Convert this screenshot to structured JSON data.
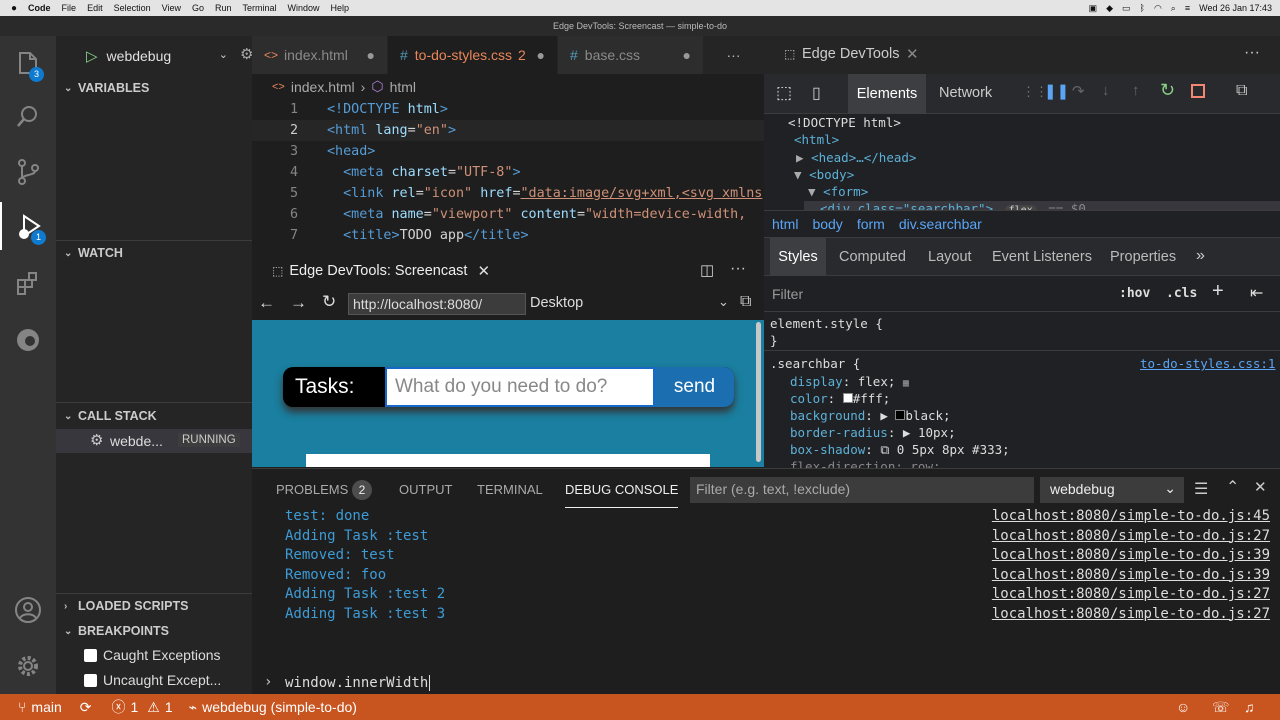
{
  "macbar": {
    "app": "Code",
    "menus": [
      "File",
      "Edit",
      "Selection",
      "View",
      "Go",
      "Run",
      "Terminal",
      "Window",
      "Help"
    ],
    "clock": "Wed 26 Jan  17:43"
  },
  "window_title": "Edge DevTools: Screencast — simple-to-do",
  "activity": {
    "explorer_badge": "3",
    "debug_badge": "1"
  },
  "sidebar": {
    "config": "webdebug",
    "variables": "VARIABLES",
    "watch": "WATCH",
    "call_stack": "CALL STACK",
    "call_stack_item": "webde...",
    "call_stack_status": "RUNNING",
    "loaded_scripts": "LOADED SCRIPTS",
    "breakpoints": "BREAKPOINTS",
    "bp1": "Caught Exceptions",
    "bp2": "Uncaught Except..."
  },
  "editor": {
    "tabs": [
      {
        "label": "index.html",
        "icon": "<>"
      },
      {
        "label": "to-do-styles.css",
        "count": "2",
        "icon": "#"
      },
      {
        "label": "base.css",
        "icon": "#"
      }
    ],
    "breadcrumb": {
      "file": "index.html",
      "node": "html"
    },
    "lines": [
      "1",
      "2",
      "3",
      "4",
      "5",
      "6",
      "7"
    ]
  },
  "screencast": {
    "tab": "Edge DevTools: Screencast",
    "url": "http://localhost:8080/",
    "device": "Desktop",
    "label": "Tasks:",
    "placeholder": "What do you need to do?",
    "send": "send"
  },
  "devtools": {
    "tab": "Edge DevTools",
    "tools": [
      "Elements",
      "Network"
    ],
    "dom": [
      "<!DOCTYPE html>",
      "<html>",
      "<head>…</head>",
      "<body>",
      "<form>"
    ],
    "dom_last": "<div class=\"searchbar\">",
    "dom_pill": "flex",
    "dom_eq": "== $0",
    "crumbs": [
      "html",
      "body",
      "form",
      "div.searchbar"
    ],
    "style_tabs": [
      "Styles",
      "Computed",
      "Layout",
      "Event Listeners",
      "Properties"
    ],
    "filter": "Filter",
    "hov": ":hov",
    "cls": ".cls",
    "element_style": "element.style {",
    "brace": "}",
    "selector": ".searchbar {",
    "source": "to-do-styles.css:1",
    "props": [
      {
        "name": "display",
        "value": "flex;"
      },
      {
        "name": "color",
        "value": "#fff;"
      },
      {
        "name": "background",
        "value": "black;"
      },
      {
        "name": "border-radius",
        "value": "10px;"
      },
      {
        "name": "box-shadow",
        "value": "0 5px 8px  #333;"
      }
    ],
    "cut_prop": "flex-direction: row;"
  },
  "panel": {
    "tabs": [
      "PROBLEMS",
      "OUTPUT",
      "TERMINAL",
      "DEBUG CONSOLE"
    ],
    "problems_count": "2",
    "filter_placeholder": "Filter (e.g. text, !exclude)",
    "session": "webdebug",
    "logs": [
      {
        "text": "test: done",
        "src": "localhost:8080/simple-to-do.js:45"
      },
      {
        "text": "Adding Task :test",
        "src": "localhost:8080/simple-to-do.js:27"
      },
      {
        "text": "Removed: test",
        "src": "localhost:8080/simple-to-do.js:39"
      },
      {
        "text": "Removed: foo",
        "src": "localhost:8080/simple-to-do.js:39"
      },
      {
        "text": "Adding Task :test 2",
        "src": "localhost:8080/simple-to-do.js:27"
      },
      {
        "text": "Adding Task :test 3",
        "src": "localhost:8080/simple-to-do.js:27"
      }
    ],
    "input": "window.innerWidth"
  },
  "status": {
    "branch": "main",
    "errors": "1",
    "warnings": "1",
    "debug": "webdebug (simple-to-do)"
  }
}
